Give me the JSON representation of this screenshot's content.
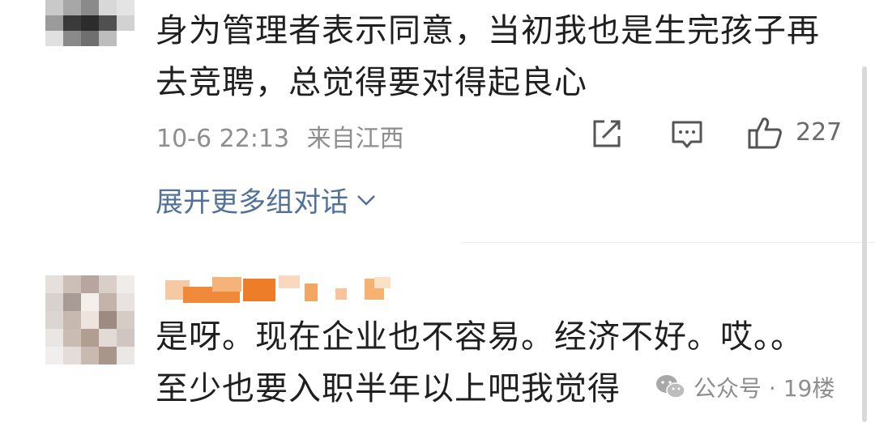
{
  "comment1": {
    "text_line1": "身为管理者表示同意，当初我也是生完孩子再",
    "text_line2": "去竞聘，总觉得要对得起良心",
    "timestamp": "10-6 22:13",
    "location": "来自江西",
    "like_count": "227",
    "icons": {
      "share": "share-icon",
      "reply": "reply-icon",
      "like": "thumbs-up-icon"
    }
  },
  "expand_link": "展开更多组对话",
  "comment2": {
    "text_line1": "是呀。现在企业也不容易。经济不好。哎。。",
    "text_line2": "至少也要入职半年以上吧我觉得"
  },
  "watermark": {
    "text": "公众号 · 19楼",
    "icon": "wechat-icon"
  },
  "colors": {
    "link": "#51719a",
    "meta": "#8e8e8e",
    "username_blur": "#f08a3a"
  }
}
